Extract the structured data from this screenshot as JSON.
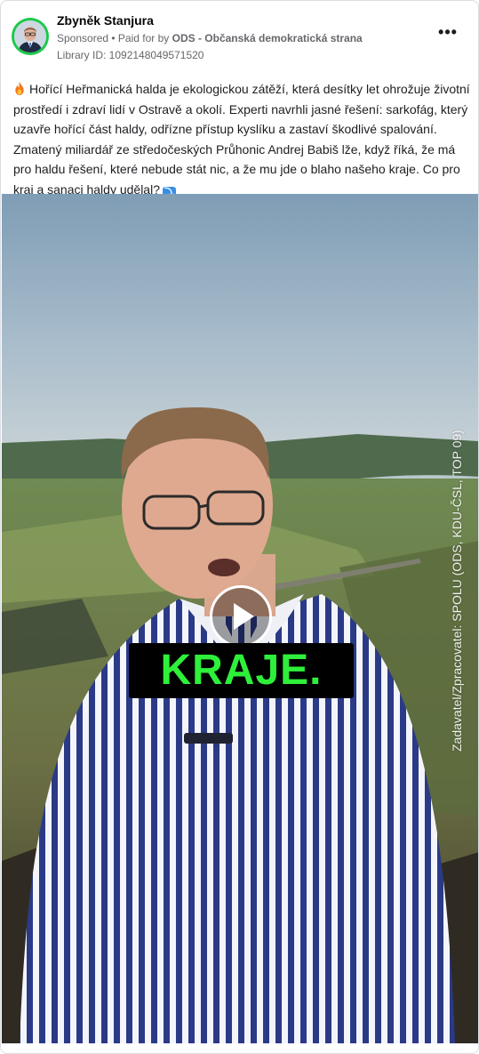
{
  "post": {
    "author": "Zbyněk Stanjura",
    "sponsored": "Sponsored",
    "separator": " • ",
    "paid_for_prefix": "Paid for by ",
    "payer": "ODS - Občanská demokratická strana",
    "library_id": "Library ID: 1092148049571520",
    "more_label": "•••",
    "text": "Hořící Heřmanická halda je ekologickou zátěží, která desítky let ohrožuje životní prostředí i zdraví lidí v Ostravě a okolí. Experti navrhli jasné řešení: sarkofág, který uzavře hořící část haldy, odřízne přístup kyslíku a zastaví škodlivé spalování. Zmatený miliardář ze středočeských Průhonic Andrej Babiš lže, když říká, že má pro haldu řešení, které nebude stát nic, a že mu jde o blaho našeho kraje. Co pro kraj a sanaci haldy udělal?",
    "arrow_emoji": "⤵"
  },
  "video": {
    "caption": "KRAJE.",
    "watermark": "Zadavatel/Zpracovatel: SPOLU (ODS, KDU-ČSL, TOP 09)"
  },
  "icons": [
    "fire-emoji-icon",
    "arrow-down-emoji-icon",
    "more-options-icon",
    "play-icon"
  ],
  "colors": {
    "avatar_ring": "#1bc94a",
    "caption_text": "#2ef03a",
    "caption_bg": "#000000",
    "secondary_text": "#65676b"
  }
}
